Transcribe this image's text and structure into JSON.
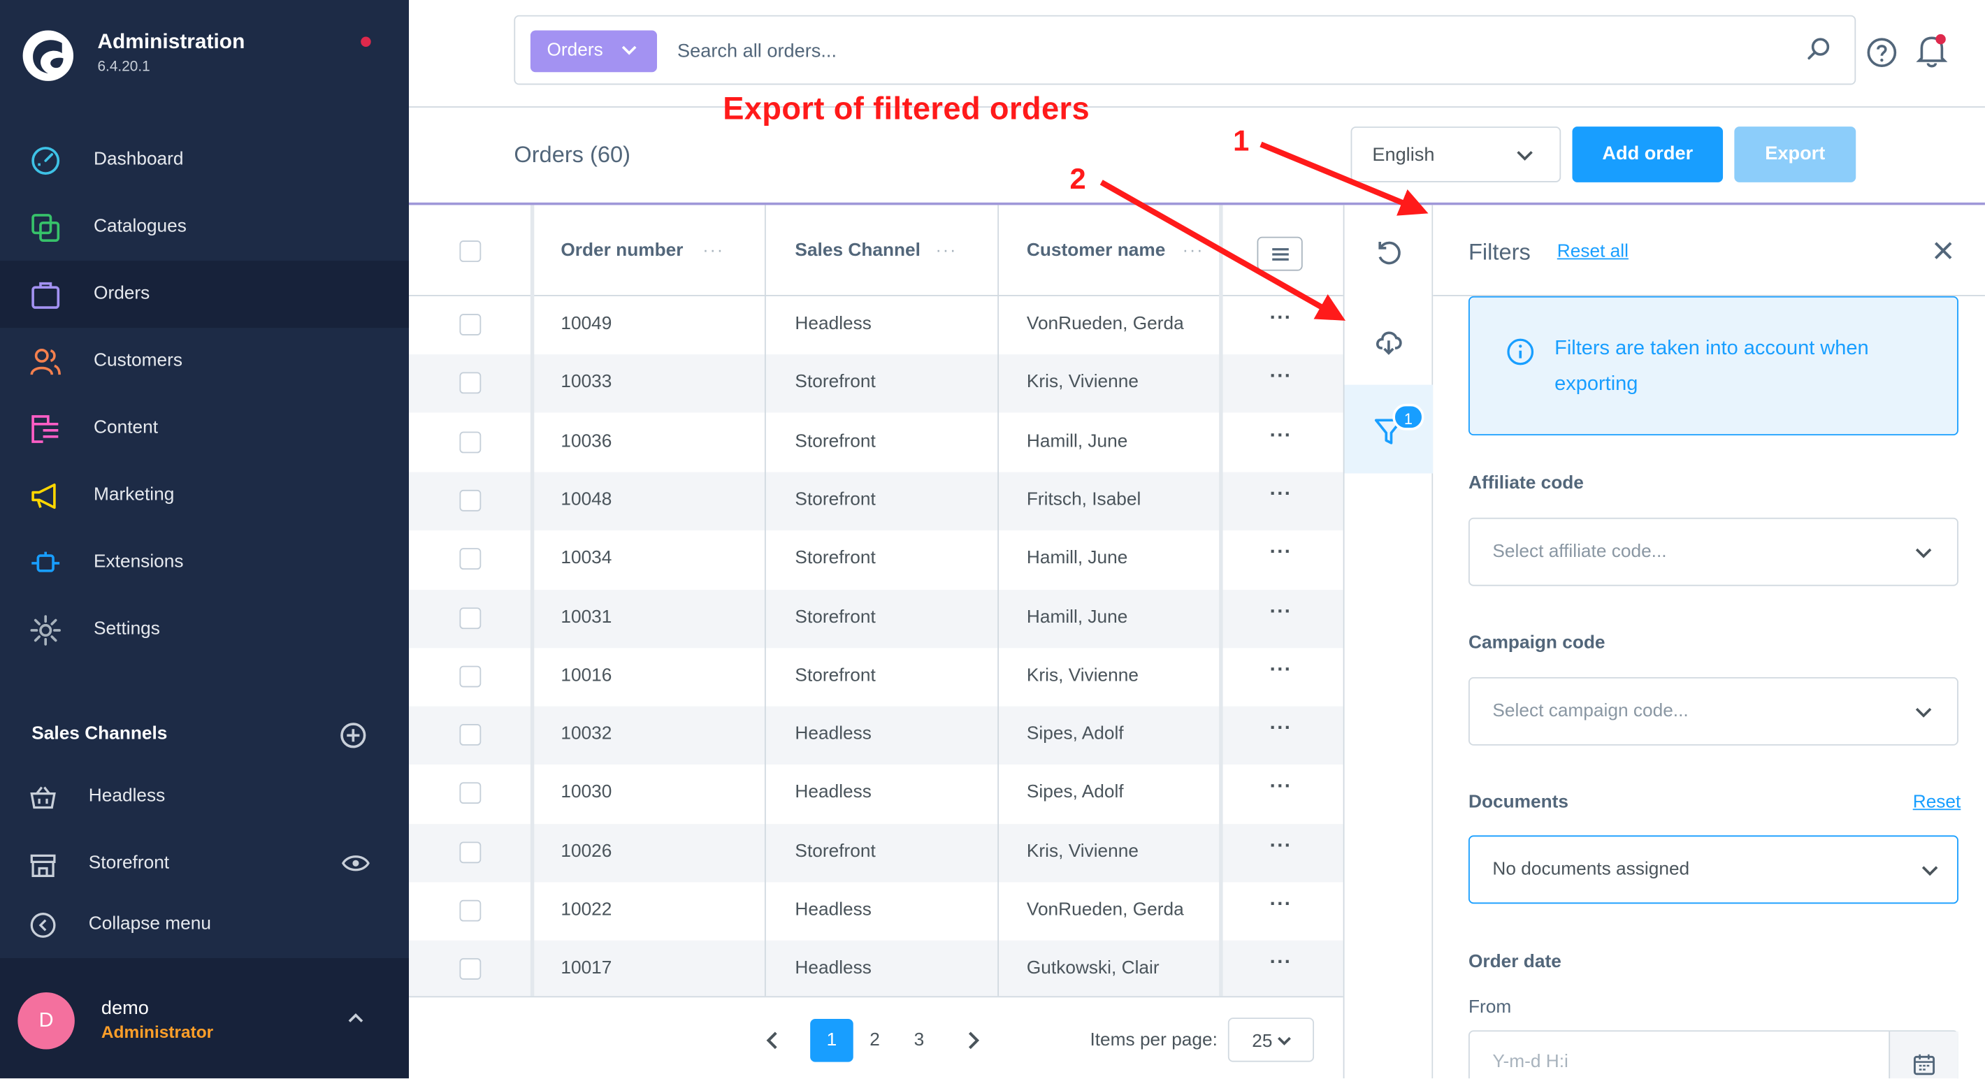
{
  "app": {
    "title": "Administration",
    "version": "6.4.20.1"
  },
  "sidebar": {
    "items": [
      {
        "label": "Dashboard",
        "icon": "dashboard-icon",
        "active": false
      },
      {
        "label": "Catalogues",
        "icon": "catalogue-icon",
        "active": false
      },
      {
        "label": "Orders",
        "icon": "orders-bag-icon",
        "active": true
      },
      {
        "label": "Customers",
        "icon": "customers-icon",
        "active": false
      },
      {
        "label": "Content",
        "icon": "content-icon",
        "active": false
      },
      {
        "label": "Marketing",
        "icon": "megaphone-icon",
        "active": false
      },
      {
        "label": "Extensions",
        "icon": "plug-icon",
        "active": false
      },
      {
        "label": "Settings",
        "icon": "gear-icon",
        "active": false
      }
    ],
    "sales_channels_title": "Sales Channels",
    "sales_channels": [
      {
        "label": "Headless",
        "icon": "basket-icon"
      },
      {
        "label": "Storefront",
        "icon": "store-icon"
      }
    ],
    "collapse_label": "Collapse menu",
    "user": {
      "initial": "D",
      "name": "demo",
      "role": "Administrator"
    }
  },
  "search": {
    "type_label": "Orders",
    "placeholder": "Search all orders..."
  },
  "header": {
    "title": "Orders (60)",
    "language": "English",
    "add_order_label": "Add order",
    "export_label": "Export"
  },
  "annotations": {
    "title": "Export of filtered orders",
    "marker_1": "1",
    "marker_2": "2"
  },
  "table": {
    "columns": [
      "Order number",
      "Sales Channel",
      "Customer name"
    ],
    "column_menu": "···",
    "row_menu": "···",
    "rows": [
      [
        "10049",
        "Headless",
        "VonRueden, Gerda"
      ],
      [
        "10033",
        "Storefront",
        "Kris, Vivienne"
      ],
      [
        "10036",
        "Storefront",
        "Hamill, June"
      ],
      [
        "10048",
        "Storefront",
        "Fritsch, Isabel"
      ],
      [
        "10034",
        "Storefront",
        "Hamill, June"
      ],
      [
        "10031",
        "Storefront",
        "Hamill, June"
      ],
      [
        "10016",
        "Storefront",
        "Kris, Vivienne"
      ],
      [
        "10032",
        "Headless",
        "Sipes, Adolf"
      ],
      [
        "10030",
        "Headless",
        "Sipes, Adolf"
      ],
      [
        "10026",
        "Storefront",
        "Kris, Vivienne"
      ],
      [
        "10022",
        "Headless",
        "VonRueden, Gerda"
      ],
      [
        "10017",
        "Headless",
        "Gutkowski, Clair"
      ]
    ]
  },
  "pagination": {
    "pages": [
      "1",
      "2",
      "3"
    ],
    "current": "1",
    "items_per_page_label": "Items per page:",
    "items_per_page": "25"
  },
  "sidebar_tools": {
    "filter_badge": "1"
  },
  "filters": {
    "title": "Filters",
    "reset_all": "Reset all",
    "info": "Filters are taken into account when exporting",
    "affiliate_label": "Affiliate code",
    "affiliate_placeholder": "Select affiliate code...",
    "campaign_label": "Campaign code",
    "campaign_placeholder": "Select campaign code...",
    "documents_label": "Documents",
    "documents_reset": "Reset",
    "documents_value": "No documents assigned",
    "order_date_label": "Order date",
    "from_label": "From",
    "date_placeholder": "Y-m-d H:i"
  },
  "colors": {
    "sidebar_bg": "#1d2b46",
    "accent": "#189eff",
    "search_type": "#a392f2",
    "annotation": "#ff1a1a"
  }
}
